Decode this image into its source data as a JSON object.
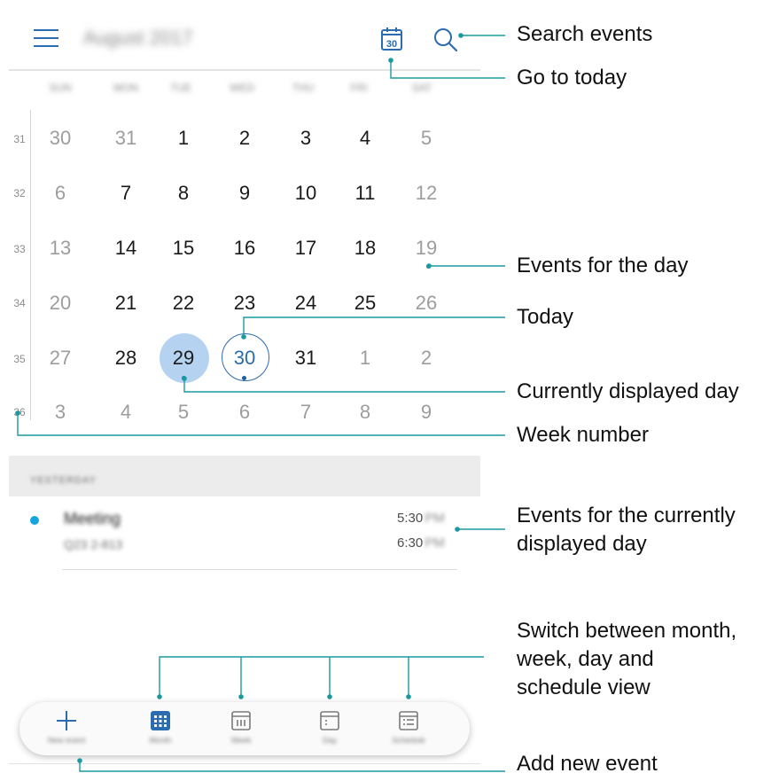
{
  "header": {
    "title": "August 2017",
    "today_icon_day": "30"
  },
  "weekdays": [
    "SUN",
    "MON",
    "TUE",
    "WED",
    "THU",
    "FRI",
    "SAT"
  ],
  "calendar": {
    "weeks": [
      {
        "number": "31",
        "days": [
          "30",
          "31",
          "1",
          "2",
          "3",
          "4",
          "5"
        ]
      },
      {
        "number": "32",
        "days": [
          "6",
          "7",
          "8",
          "9",
          "10",
          "11",
          "12"
        ]
      },
      {
        "number": "33",
        "days": [
          "13",
          "14",
          "15",
          "16",
          "17",
          "18",
          "19"
        ]
      },
      {
        "number": "34",
        "days": [
          "20",
          "21",
          "22",
          "23",
          "24",
          "25",
          "26"
        ]
      },
      {
        "number": "35",
        "days": [
          "27",
          "28",
          "29",
          "30",
          "31",
          "1",
          "2"
        ]
      },
      {
        "number": "36",
        "days": [
          "3",
          "4",
          "5",
          "6",
          "7",
          "8",
          "9"
        ]
      }
    ]
  },
  "agenda": {
    "section_label": "YESTERDAY",
    "event": {
      "title": "Meeting",
      "location": "Q23 2-813",
      "start_time": "5:30",
      "end_time": "6:30",
      "am_pm": "PM",
      "color": "#15a6dd"
    }
  },
  "bottom_nav": {
    "new_event": "New event",
    "month": "Month",
    "week": "Week",
    "day": "Day",
    "schedule": "Schedule"
  },
  "callouts": {
    "search": "Search events",
    "today": "Go to today",
    "events_day": "Events for the day",
    "today_marker": "Today",
    "current_day": "Currently displayed day",
    "week_number": "Week number",
    "events_current_1": "Events for the currently",
    "events_current_2": "displayed day",
    "switch_1": "Switch between month,",
    "switch_2": "week, day and",
    "switch_3": "schedule view",
    "add_event": "Add new event"
  },
  "colors": {
    "accent": "#2b6cb0",
    "selected_day_bg": "#b5d3f1",
    "callout_line": "#1a9aa0"
  }
}
